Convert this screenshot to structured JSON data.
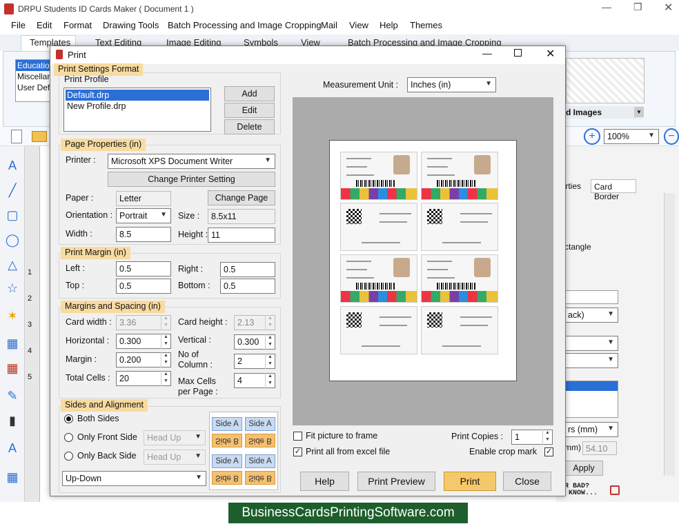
{
  "app": {
    "title": "DRPU Students ID Cards Maker ( Document 1 )",
    "menu": [
      "File",
      "Edit",
      "Format",
      "Drawing Tools",
      "Batch Processing and Image Cropping",
      "Mail",
      "View",
      "Help",
      "Themes"
    ],
    "ribbon_tabs": [
      "Templates",
      "Text Editing",
      "Image Editing",
      "Symbols",
      "View",
      "Batch Processing and Image Cropping"
    ],
    "template_list": [
      "Educatio",
      "Miscellan",
      "User Defi"
    ],
    "images_label": "d Images",
    "zoom": "100%",
    "right_tabs": [
      "perties",
      "Card Border"
    ],
    "right_texts": [
      "ctangle",
      "ack)",
      "rs (mm)",
      "mm)",
      "54.10",
      "Apply"
    ],
    "ruler_numbers": [
      "1",
      "2",
      "3",
      "4",
      "5"
    ],
    "status_text": "OR BAD?\nS KNOW..."
  },
  "dialog": {
    "title": "Print",
    "print_settings_format": "Print Settings Format",
    "print_profile_label": "Print Profile",
    "profiles": [
      "Default.drp",
      "New Profile.drp"
    ],
    "add": "Add",
    "edit": "Edit",
    "delete": "Delete",
    "page_properties": "Page Properties  (in)",
    "printer_label": "Printer :",
    "printer": "Microsoft XPS Document Writer",
    "change_printer": "Change Printer Setting",
    "paper_label": "Paper :",
    "paper": "Letter",
    "change_page": "Change Page",
    "orientation_label": "Orientation :",
    "orientation": "Portrait",
    "size_label": "Size :",
    "size": "8.5x11",
    "width_label": "Width :",
    "width": "8.5",
    "height_label": "Height :",
    "height": "11",
    "print_margin": "Print Margin  (in)",
    "left_label": "Left :",
    "left": "0.5",
    "right_label": "Right :",
    "right": "0.5",
    "top_label": "Top :",
    "top": "0.5",
    "bottom_label": "Bottom :",
    "bottom": "0.5",
    "margins_spacing": "Margins and Spacing  (in)",
    "card_width_label": "Card width :",
    "card_width": "3.36",
    "card_height_label": "Card height :",
    "card_height": "2.13",
    "horizontal_label": "Horizontal :",
    "horizontal": "0.300",
    "vertical_label": "Vertical :",
    "vertical": "0.300",
    "margin_label": "Margin :",
    "margin": "0.200",
    "no_column_label": "No of\nColumn :",
    "no_column": "2",
    "total_cells_label": "Total Cells :",
    "total_cells": "20",
    "max_cells_label": "Max Cells\nper Page :",
    "max_cells": "4",
    "sides_alignment": "Sides and Alignment",
    "both_sides": "Both Sides",
    "only_front": "Only Front Side",
    "only_back": "Only Back Side",
    "head_up": "Head Up",
    "up_down": "Up-Down",
    "side_a": "Side A",
    "side_b": "Side B",
    "measurement_unit_label": "Measurement Unit :",
    "measurement_unit": "Inches (in)",
    "fit_picture": "Fit picture to frame",
    "print_all_excel": "Print all from excel file",
    "print_copies_label": "Print Copies :",
    "print_copies": "1",
    "enable_crop": "Enable crop mark",
    "help": "Help",
    "print_preview": "Print Preview",
    "print": "Print",
    "close": "Close"
  },
  "footer": "BusinessCardsPrintingSoftware.com"
}
